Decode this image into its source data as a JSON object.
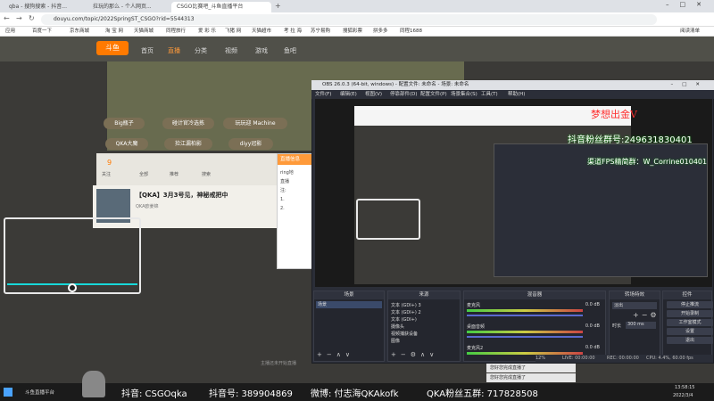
{
  "browser": {
    "tabs": [
      {
        "label": "qba - 搜狗搜索 - 抖音..."
      },
      {
        "label": "拉玩的那么 - 个人网页..."
      },
      {
        "label": "CSGO比赛吧_斗鱼直播平台"
      }
    ],
    "url": "douyu.com/topic/2022SpringST_CSGO?rid=5544313",
    "bookmarks": [
      "应用",
      "百度一下",
      "京东商城",
      "淘 宝 网",
      "天猫商城",
      "同程旅行",
      "爱 彩 乐",
      "飞猪 网",
      "天猫超市",
      "考 拉 海",
      "苏宁易购",
      "搜狐彩票",
      "拼多多",
      "同程1688"
    ],
    "reading_list": "阅读清单"
  },
  "site": {
    "logo": "斗鱼",
    "nav": [
      "首页",
      "直播",
      "分类",
      "视频",
      "游戏",
      "鱼吧"
    ],
    "pills": [
      "Big瓶子",
      "碰计官冷选拣",
      "玩玩迎 Machine",
      "QKA大魔",
      "捡江漏柏影",
      "diyy冠影"
    ],
    "stats": [
      "9",
      "关注",
      "全部",
      "推荐",
      "搜索"
    ],
    "room_title": "【QKA】3月3号见，神秘戒把中",
    "room_sub": "QKA欧姜锦",
    "popup_title": "直播信息",
    "popup_lines": [
      "ring地",
      "直播",
      "注:",
      "1.",
      "2."
    ],
    "footer": "主播还未开始直播"
  },
  "obs": {
    "title": "OBS 26.0.3 (64-bit, windows) - 配置文件: 未命名 - 场景: 未命名",
    "menu": [
      "文件(F)",
      "编辑(E)",
      "视图(V)",
      "停靠部件(D)",
      "配置文件(P)",
      "场景集合(S)",
      "工具(T)",
      "帮助(H)"
    ],
    "docks": {
      "scenes": {
        "title": "场景",
        "items": [
          "场景"
        ]
      },
      "sources": {
        "title": "来源",
        "items": [
          "文本 (GDI+) 3",
          "文本 (GDI+) 2",
          "文本 (GDI+)",
          "摄像头",
          "视频捕获设备",
          "图像"
        ]
      },
      "mixer": {
        "title": "混音器",
        "channels": [
          "麦克风",
          "桌面音频",
          "麦克风2"
        ],
        "levels": [
          "0.0 dB",
          "0.0 dB",
          "0.0 dB"
        ]
      },
      "transitions": {
        "title": "转场特效",
        "type": "淡出",
        "duration_label": "时长",
        "duration": "300 ms"
      },
      "controls": {
        "title": "控件",
        "buttons": [
          "停止推流",
          "开始录制",
          "工作室模式",
          "设置",
          "退出"
        ]
      }
    },
    "status": {
      "live": "LIVE: 00:00:00",
      "rec": "REC: 00:00:00",
      "cpu": "CPU: 4.4%, 60.00 fps",
      "dropped": "12%"
    }
  },
  "overlay": {
    "red_line": "梦想出金V",
    "promo_1": "抖音粉丝群号:249631830401",
    "promo_2": "渠道FPS精简群：W_Corrine010401",
    "bottom": [
      "抖音: CSGOqka",
      "抖音号: 389904869",
      "微博: 付志海QKAkofk",
      "QKA粉丝五群: 717828508"
    ]
  },
  "taskbar": {
    "start": "斗鱼直播平台",
    "time": "13:58:15",
    "date": "2022/3/4",
    "sidebar_texts": [
      "您好您完成直播了",
      "您好您完成直播了"
    ]
  },
  "colors": {
    "accent_red": "#ff3030",
    "douyu_orange": "#ff7a00",
    "obs_bg": "#2b2e38"
  }
}
